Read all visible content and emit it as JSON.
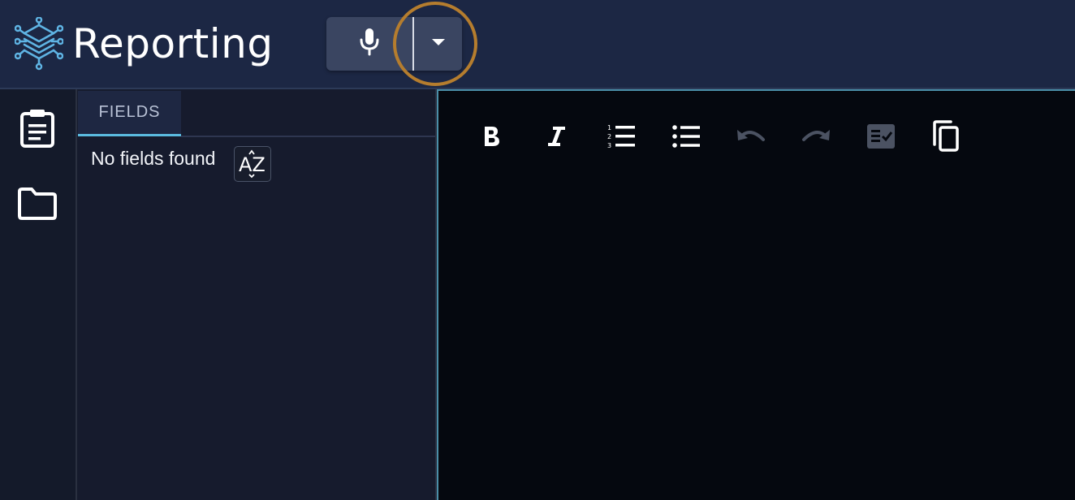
{
  "header": {
    "title": "Reporting",
    "logo_icon": "neural-network-icon",
    "mic_icon": "microphone-icon",
    "dropdown_icon": "caret-down-icon",
    "colors": {
      "background": "#1c2744",
      "button": "#3a4561",
      "highlight_ring": "#b57d2e",
      "logo": "#5fb4e4"
    }
  },
  "rail": {
    "items": [
      {
        "icon": "clipboard-icon"
      },
      {
        "icon": "folder-icon"
      }
    ]
  },
  "fields_panel": {
    "tab_label": "FIELDS",
    "empty_message": "No fields found",
    "sort_icon": "sort-az-icon",
    "sort_label": "AZ",
    "accent": "#5bbbe0"
  },
  "editor": {
    "toolbar": [
      {
        "icon": "bold-icon",
        "enabled": true
      },
      {
        "icon": "italic-icon",
        "enabled": true
      },
      {
        "icon": "numbered-list-icon",
        "enabled": true
      },
      {
        "icon": "bulleted-list-icon",
        "enabled": true
      },
      {
        "icon": "undo-icon",
        "enabled": false
      },
      {
        "icon": "redo-icon",
        "enabled": false
      },
      {
        "icon": "checklist-icon",
        "enabled": false
      },
      {
        "icon": "copy-icon",
        "enabled": true
      }
    ],
    "border_color": "#4a8ea8"
  }
}
